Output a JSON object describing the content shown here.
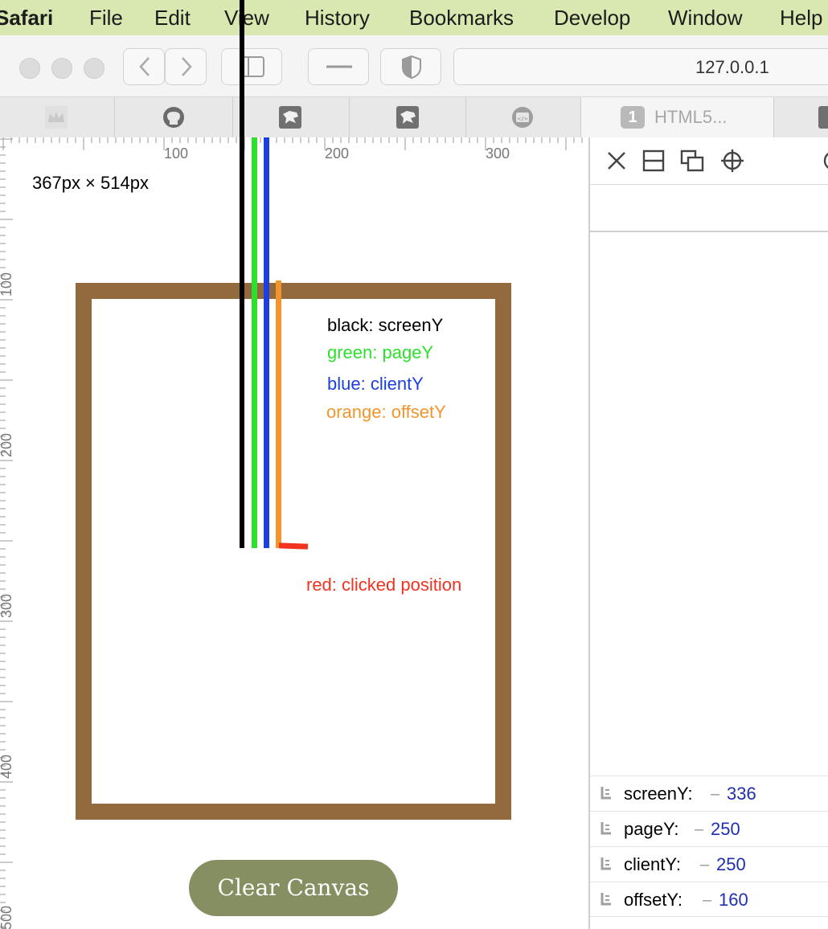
{
  "menubar": {
    "app": "Safari",
    "items": [
      "File",
      "Edit",
      "View",
      "History",
      "Bookmarks",
      "Develop",
      "Window",
      "Help"
    ]
  },
  "toolbar": {
    "address": "127.0.0.1"
  },
  "tabs": {
    "html5_badge": "1",
    "html5_label": "HTML5..."
  },
  "page": {
    "ruler_top_labels": [
      "100",
      "200",
      "300"
    ],
    "ruler_left_labels": [
      "100",
      "200",
      "300",
      "400",
      "500"
    ],
    "dimensions": "367px × 514px",
    "legend": {
      "black": "black: screenY",
      "green": "green: pageY",
      "blue": "blue: clientY",
      "orange": "orange: offsetY",
      "red": "red: clicked position"
    },
    "clear_button": "Clear Canvas",
    "colors": {
      "frame": "#936a3d",
      "black": "#000000",
      "green": "#2ee02e",
      "blue": "#1c3fe0",
      "orange": "#f3952d",
      "red": "#f2331f"
    }
  },
  "console": {
    "entries": [
      {
        "key": "screenY:",
        "value": "336"
      },
      {
        "key": "pageY:",
        "value": "250"
      },
      {
        "key": "clientY:",
        "value": "250"
      },
      {
        "key": "offsetY:",
        "value": "160"
      }
    ]
  }
}
